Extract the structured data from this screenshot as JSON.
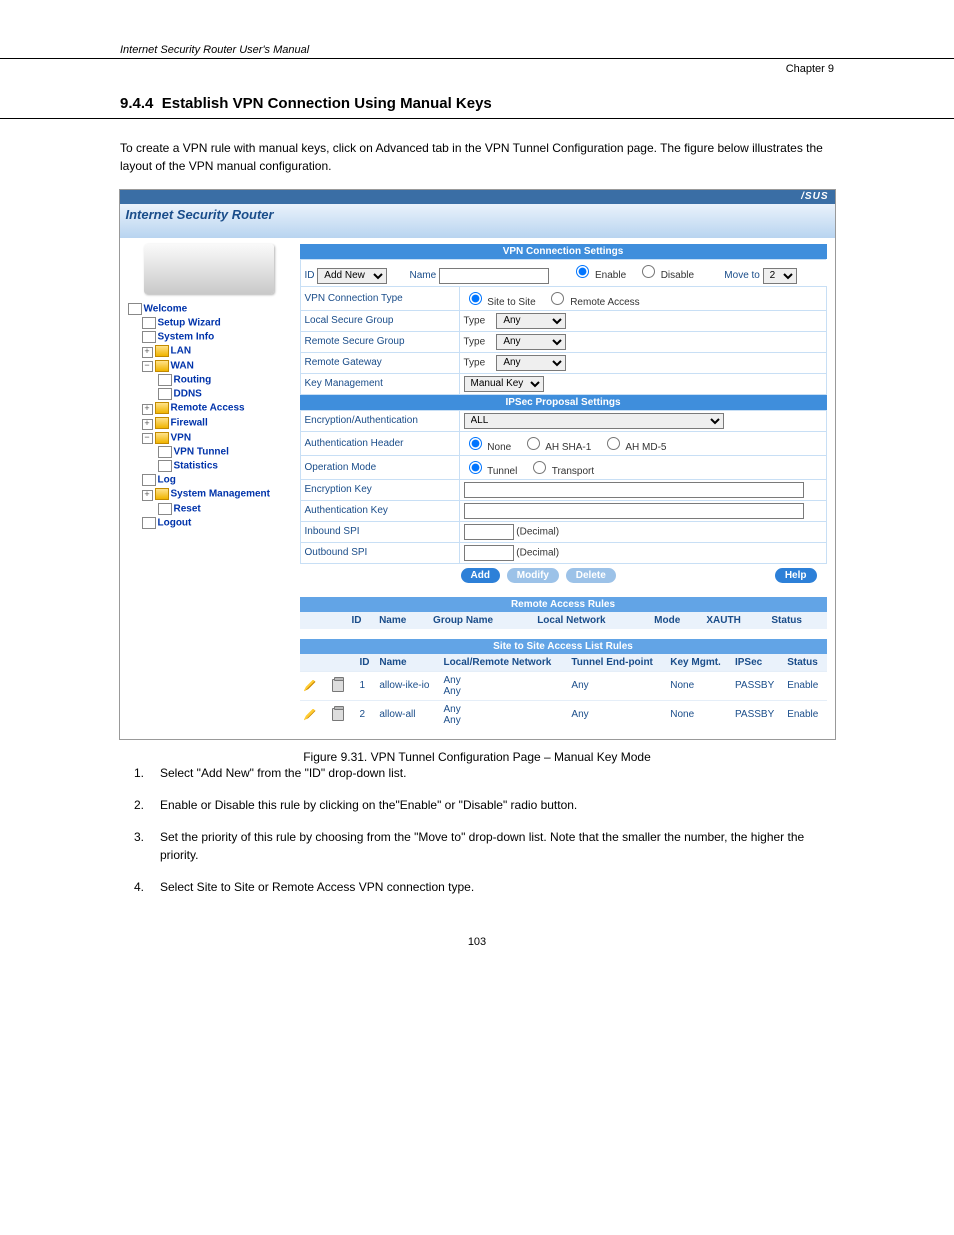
{
  "doc": {
    "running_header": "Internet Security Router User's Manual",
    "chapter": "Chapter 9",
    "section_number": "9.4.4",
    "section_title": "Establish VPN Connection Using Manual Keys",
    "intro": "To create a VPN rule with manual keys, click on Advanced tab in the VPN Tunnel Configuration page. The figure below illustrates the layout of the VPN manual configuration.",
    "figure_ref": "Figure 9.31. VPN Tunnel Configuration Page – Manual Key Mode",
    "step1_num": "1.",
    "step1": "Select \"Add New\" from the \"ID\" drop-down list.",
    "step2_num": "2.",
    "step2": "Enable or Disable this rule by clicking on the\"Enable\" or \"Disable\" radio button.",
    "step3_num": "3.",
    "step3": "Set the priority of this rule by choosing from the \"Move to\" drop-down list. Note that the smaller the number, the higher the priority.",
    "step4_num": "4.",
    "step4": "Select Site to Site or Remote Access VPN connection type.",
    "page_number": "103"
  },
  "ui": {
    "brand": "/SUS",
    "product": "Internet Security Router",
    "tree": {
      "welcome": "Welcome",
      "setup_wizard": "Setup Wizard",
      "system_info": "System Info",
      "lan": "LAN",
      "wan": "WAN",
      "routing": "Routing",
      "ddns": "DDNS",
      "remote_access": "Remote Access",
      "firewall": "Firewall",
      "vpn": "VPN",
      "vpn_tunnel": "VPN Tunnel",
      "statistics": "Statistics",
      "log": "Log",
      "system_management": "System Management",
      "reset": "Reset",
      "logout": "Logout"
    },
    "panel": {
      "title": "VPN Connection Settings",
      "id_label": "ID",
      "id_value": "Add New",
      "name_label": "Name",
      "name_value": "",
      "enable": "Enable",
      "disable": "Disable",
      "move_to": "Move to",
      "move_to_value": "2",
      "conn_type": "VPN Connection Type",
      "site_to_site": "Site to Site",
      "remote_access_radio": "Remote Access",
      "local_secure_group": "Local Secure Group",
      "remote_secure_group": "Remote Secure Group",
      "remote_gateway": "Remote Gateway",
      "type_label": "Type",
      "type_value": "Any",
      "key_mgmt": "Key Management",
      "key_mgmt_value": "Manual Key",
      "ipsec_title": "IPSec Proposal Settings",
      "enc_auth": "Encryption/Authentication",
      "enc_auth_value": "ALL",
      "auth_header": "Authentication Header",
      "ah_none": "None",
      "ah_sha1": "AH SHA-1",
      "ah_md5": "AH MD-5",
      "op_mode": "Operation Mode",
      "tunnel": "Tunnel",
      "transport": "Transport",
      "enc_key": "Encryption Key",
      "auth_key": "Authentication Key",
      "inbound_spi": "Inbound SPI",
      "outbound_spi": "Outbound SPI",
      "decimal": "(Decimal)",
      "btn_add": "Add",
      "btn_modify": "Modify",
      "btn_delete": "Delete",
      "btn_help": "Help"
    },
    "remote_rules": {
      "title": "Remote Access Rules",
      "h_id": "ID",
      "h_name": "Name",
      "h_group": "Group Name",
      "h_local": "Local Network",
      "h_mode": "Mode",
      "h_xauth": "XAUTH",
      "h_status": "Status"
    },
    "site_rules": {
      "title": "Site to Site Access List Rules",
      "h_id": "ID",
      "h_name": "Name",
      "h_lr": "Local/Remote Network",
      "h_tunnel": "Tunnel End-point",
      "h_key": "Key Mgmt.",
      "h_ipsec": "IPSec",
      "h_status": "Status",
      "rows": [
        {
          "id": "1",
          "name": "allow-ike-io",
          "lr1": "Any",
          "lr2": "Any",
          "tunnel": "Any",
          "key": "None",
          "ipsec": "PASSBY",
          "status": "Enable"
        },
        {
          "id": "2",
          "name": "allow-all",
          "lr1": "Any",
          "lr2": "Any",
          "tunnel": "Any",
          "key": "None",
          "ipsec": "PASSBY",
          "status": "Enable"
        }
      ]
    }
  }
}
